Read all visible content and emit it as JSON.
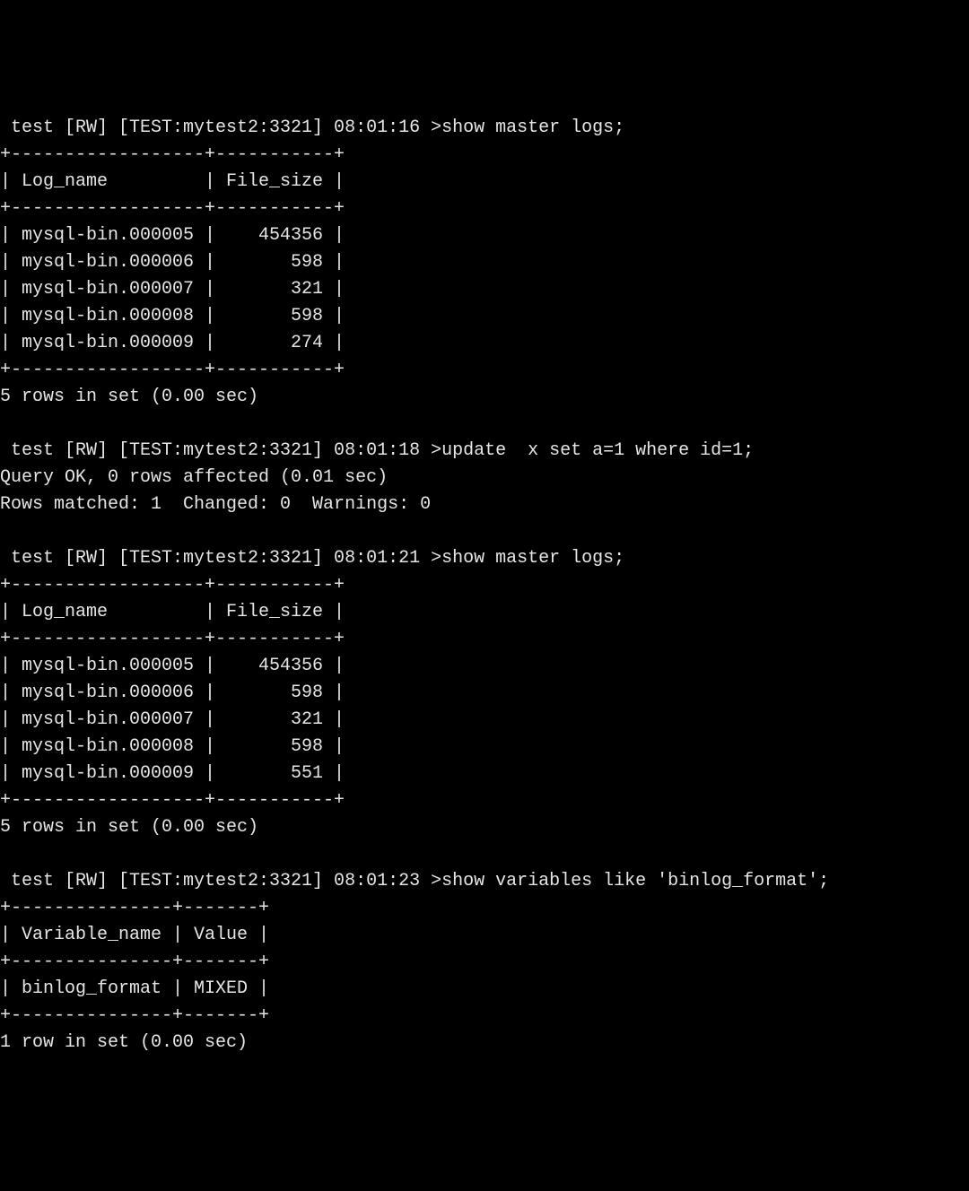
{
  "block1": {
    "prompt": " test [RW] [TEST:mytest2:3321] 08:01:16 >show master logs;",
    "border": "+------------------+-----------+",
    "header": "| Log_name         | File_size |",
    "rows": [
      "| mysql-bin.000005 |    454356 |",
      "| mysql-bin.000006 |       598 |",
      "| mysql-bin.000007 |       321 |",
      "| mysql-bin.000008 |       598 |",
      "| mysql-bin.000009 |       274 |"
    ],
    "summary": "5 rows in set (0.00 sec)"
  },
  "block2": {
    "prompt": " test [RW] [TEST:mytest2:3321] 08:01:18 >update  x set a=1 where id=1;",
    "result1": "Query OK, 0 rows affected (0.01 sec)",
    "result2": "Rows matched: 1  Changed: 0  Warnings: 0"
  },
  "block3": {
    "prompt": " test [RW] [TEST:mytest2:3321] 08:01:21 >show master logs;",
    "border": "+------------------+-----------+",
    "header": "| Log_name         | File_size |",
    "rows": [
      "| mysql-bin.000005 |    454356 |",
      "| mysql-bin.000006 |       598 |",
      "| mysql-bin.000007 |       321 |",
      "| mysql-bin.000008 |       598 |",
      "| mysql-bin.000009 |       551 |"
    ],
    "summary": "5 rows in set (0.00 sec)"
  },
  "block4": {
    "prompt": " test [RW] [TEST:mytest2:3321] 08:01:23 >show variables like 'binlog_format';",
    "border": "+---------------+-------+",
    "header": "| Variable_name | Value |",
    "rows": [
      "| binlog_format | MIXED |"
    ],
    "summary": "1 row in set (0.00 sec)"
  }
}
